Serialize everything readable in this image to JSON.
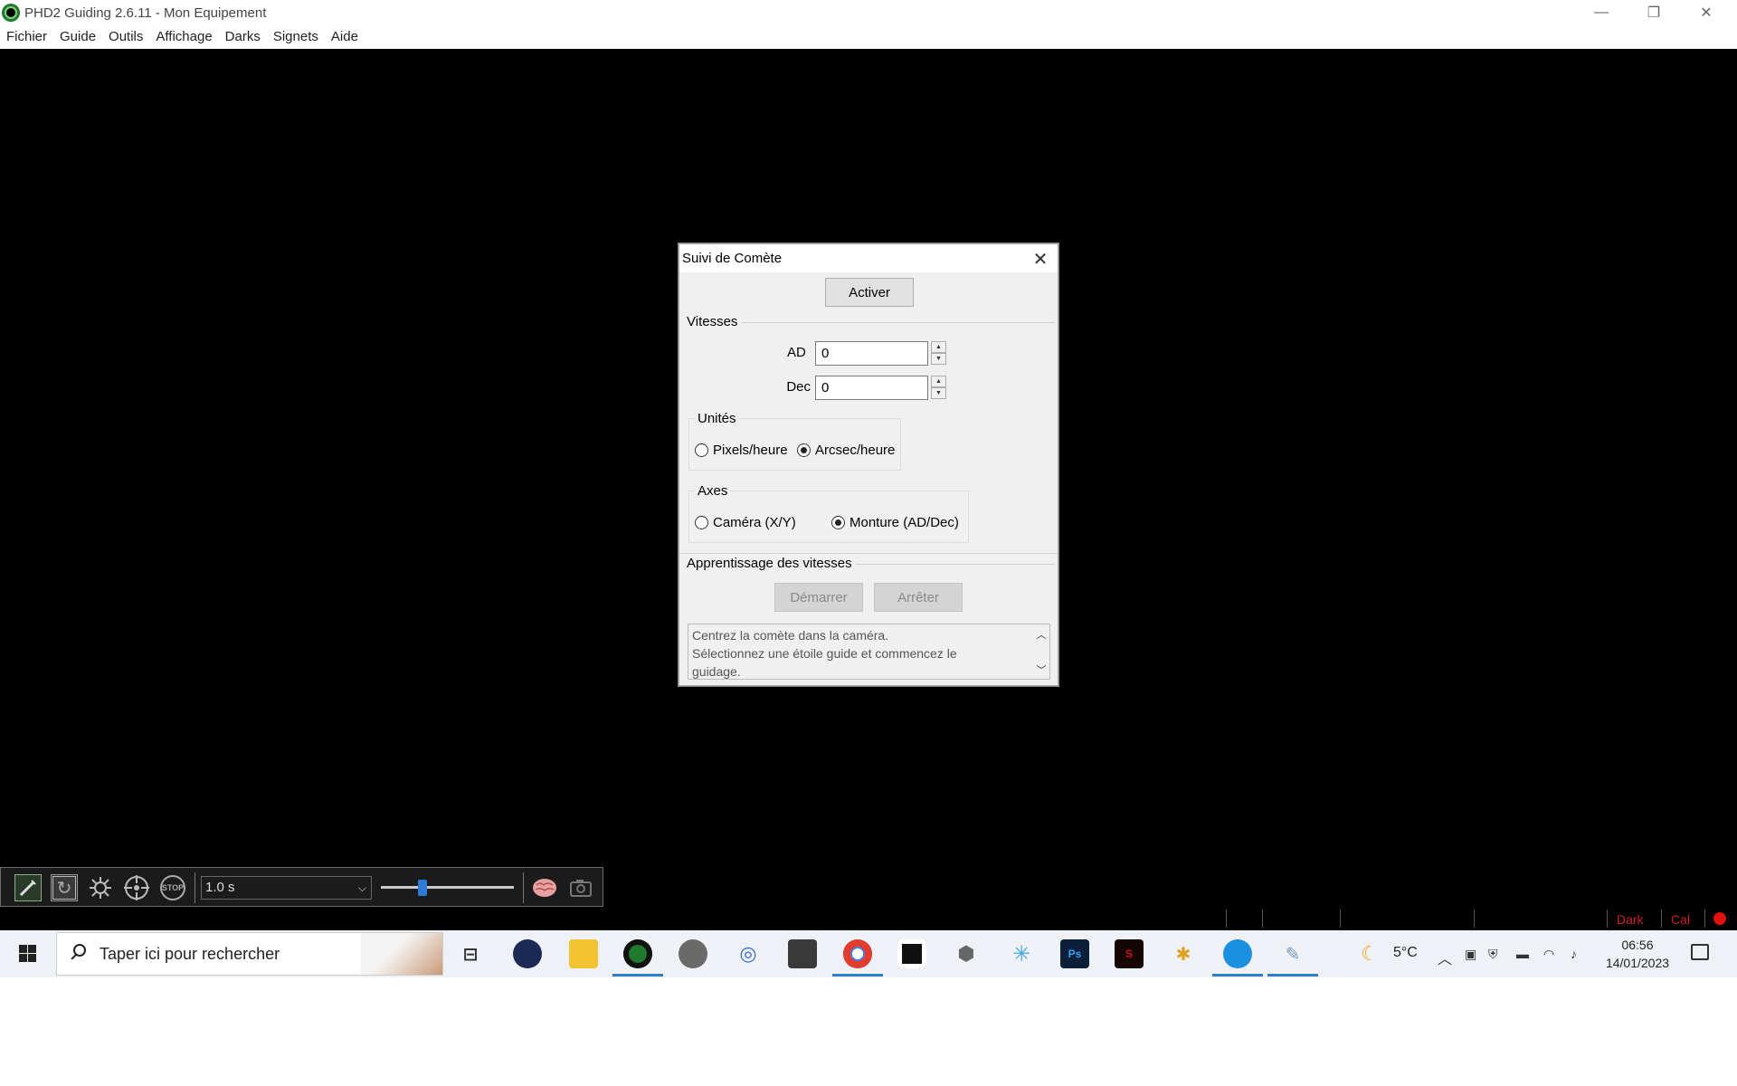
{
  "window": {
    "title": "PHD2 Guiding 2.6.11 - Mon Equipement",
    "minimize_glyph": "—",
    "maximize_glyph": "❐",
    "close_glyph": "✕"
  },
  "menu": [
    "Fichier",
    "Guide",
    "Outils",
    "Affichage",
    "Darks",
    "Signets",
    "Aide"
  ],
  "dialog": {
    "title": "Suivi de Comète",
    "close_glyph": "✕",
    "activate_label": "Activer",
    "rates_section": "Vitesses",
    "ra_label": "AD",
    "ra_value": "0",
    "dec_label": "Dec",
    "dec_value": "0",
    "units_group": "Unités",
    "units_pixels": "Pixels/heure",
    "units_arcsec": "Arcsec/heure",
    "units_selected": "Arcsec/heure",
    "axes_group": "Axes",
    "axes_camera": "Caméra (X/Y)",
    "axes_mount": "Monture (AD/Dec)",
    "axes_selected": "Monture (AD/Dec)",
    "learn_section": "Apprentissage des vitesses",
    "start_label": "Démarrer",
    "stop_label": "Arrêter",
    "info_text_1": "Centrez la comète dans la caméra.",
    "info_text_2": "Sélectionnez une étoile guide et commencez le",
    "info_text_3": "guidage."
  },
  "toolbar": {
    "exposure_value": "1.0 s",
    "stop_label": "STOP",
    "gamma_fraction": 0.3
  },
  "statusbar": {
    "dark_flag": "Dark",
    "cal_flag": "Cal",
    "flag_color": "#d02020"
  },
  "taskbar": {
    "search_placeholder": "Taper ici pour rechercher",
    "weather_temp": "5°C",
    "time": "06:56",
    "date": "14/01/2023",
    "accent_color": "#2b7cd3"
  }
}
